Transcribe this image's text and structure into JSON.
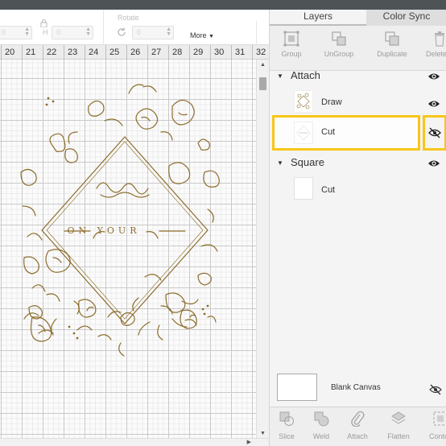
{
  "toolbar": {
    "h_label": "H",
    "h_value": "0",
    "w_value": "0",
    "rotate_label": "Rotate",
    "rotate_value": "0",
    "more_label": "More",
    "lock_icon": "lock-icon",
    "rotate_icon": "rotate-icon"
  },
  "ruler": {
    "numbers": [
      "20",
      "21",
      "22",
      "23",
      "24",
      "25",
      "26",
      "27",
      "28",
      "29",
      "30",
      "31",
      "32"
    ]
  },
  "canvas": {
    "artwork_text": "ON YOUR",
    "artwork_color": "#8c6d2c"
  },
  "panel": {
    "tabs": [
      {
        "label": "Layers",
        "active": true
      },
      {
        "label": "Color Sync",
        "active": false
      }
    ],
    "actions": [
      {
        "label": "Group",
        "icon": "group-icon"
      },
      {
        "label": "UnGroup",
        "icon": "ungroup-icon"
      },
      {
        "label": "Duplicate",
        "icon": "duplicate-icon"
      },
      {
        "label": "Delete",
        "icon": "trash-icon"
      }
    ],
    "groups": [
      {
        "name": "Attach",
        "layers": [
          {
            "name": "Draw",
            "visible": true
          },
          {
            "name": "Cut",
            "visible": false,
            "highlighted": true
          }
        ]
      },
      {
        "name": "Square",
        "layers": [
          {
            "name": "Cut",
            "visible": true
          }
        ]
      }
    ],
    "blank_canvas_label": "Blank Canvas",
    "bottom_actions": [
      {
        "label": "Slice",
        "icon": "slice-icon"
      },
      {
        "label": "Weld",
        "icon": "weld-icon"
      },
      {
        "label": "Attach",
        "icon": "attach-icon"
      },
      {
        "label": "Flatten",
        "icon": "flatten-icon"
      },
      {
        "label": "Contour",
        "icon": "contour-icon"
      }
    ],
    "highlight_color": "#f7c61a"
  }
}
